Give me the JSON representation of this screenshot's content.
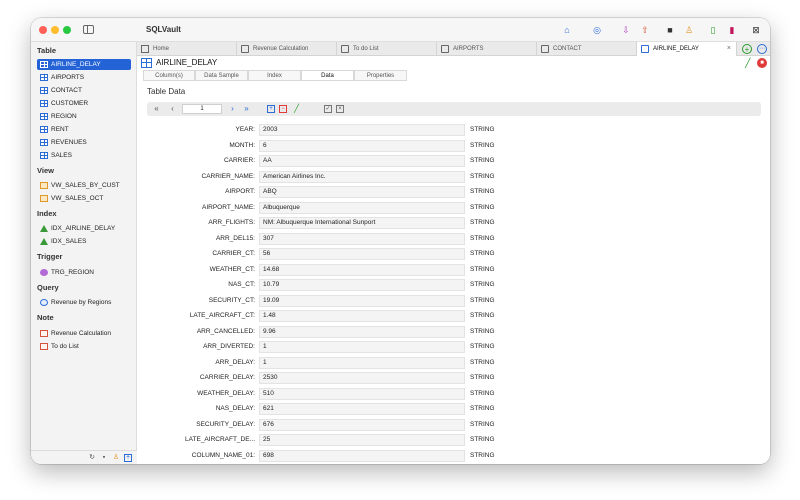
{
  "app": {
    "title": "SQLVault"
  },
  "sidebar": {
    "sections": [
      {
        "heading": "Table",
        "items": [
          {
            "label": "AIRLINE_DELAY",
            "icon": "table-icon",
            "selected": true
          },
          {
            "label": "AIRPORTS",
            "icon": "table-icon"
          },
          {
            "label": "CONTACT",
            "icon": "table-icon"
          },
          {
            "label": "CUSTOMER",
            "icon": "table-icon"
          },
          {
            "label": "REGION",
            "icon": "table-icon"
          },
          {
            "label": "RENT",
            "icon": "table-icon"
          },
          {
            "label": "REVENUES",
            "icon": "table-icon"
          },
          {
            "label": "SALES",
            "icon": "table-icon"
          }
        ]
      },
      {
        "heading": "View",
        "items": [
          {
            "label": "VW_SALES_BY_CUST",
            "icon": "view-icon"
          },
          {
            "label": "VW_SALES_OCT",
            "icon": "view-icon"
          }
        ]
      },
      {
        "heading": "Index",
        "items": [
          {
            "label": "IDX_AIRLINE_DELAY",
            "icon": "index-icon"
          },
          {
            "label": "IDX_SALES",
            "icon": "index-icon"
          }
        ]
      },
      {
        "heading": "Trigger",
        "items": [
          {
            "label": "TRG_REGION",
            "icon": "trigger-icon"
          }
        ]
      },
      {
        "heading": "Query",
        "items": [
          {
            "label": "Revenue by Regions",
            "icon": "query-icon"
          }
        ]
      },
      {
        "heading": "Note",
        "items": [
          {
            "label": "Revenue Calculation",
            "icon": "note-icon"
          },
          {
            "label": "To do List",
            "icon": "note-icon"
          }
        ]
      }
    ]
  },
  "tabs": [
    {
      "label": "Home",
      "icon": "home-icon"
    },
    {
      "label": "Revenue Calculation",
      "icon": "note-icon"
    },
    {
      "label": "To do List",
      "icon": "note-icon"
    },
    {
      "label": "AIRPORTS",
      "icon": "table-icon"
    },
    {
      "label": "CONTACT",
      "icon": "table-icon"
    },
    {
      "label": "AIRLINE_DELAY",
      "icon": "table-icon",
      "active": true,
      "close": "×"
    }
  ],
  "object": {
    "title": "AIRLINE_DELAY"
  },
  "subtabs": [
    {
      "label": "Column(s)"
    },
    {
      "label": "Data Sample"
    },
    {
      "label": "Index"
    },
    {
      "label": "Data",
      "active": true
    },
    {
      "label": "Properties"
    }
  ],
  "table_data": {
    "title": "Table Data",
    "current_page": "1",
    "rows": [
      {
        "name": "YEAR:",
        "value": "2003",
        "type": "STRING"
      },
      {
        "name": "MONTH:",
        "value": "6",
        "type": "STRING"
      },
      {
        "name": "CARRIER:",
        "value": "AA",
        "type": "STRING"
      },
      {
        "name": "CARRIER_NAME:",
        "value": "American Airlines Inc.",
        "type": "STRING"
      },
      {
        "name": "AIRPORT:",
        "value": "ABQ",
        "type": "STRING"
      },
      {
        "name": "AIRPORT_NAME:",
        "value": "Albuquerque",
        "type": "STRING"
      },
      {
        "name": "ARR_FLIGHTS:",
        "value": " NM: Albuquerque International Sunport",
        "type": "STRING"
      },
      {
        "name": "ARR_DEL15:",
        "value": "307",
        "type": "STRING"
      },
      {
        "name": "CARRIER_CT:",
        "value": "56",
        "type": "STRING"
      },
      {
        "name": "WEATHER_CT:",
        "value": "14.68",
        "type": "STRING"
      },
      {
        "name": "NAS_CT:",
        "value": "10.79",
        "type": "STRING"
      },
      {
        "name": "SECURITY_CT:",
        "value": "19.09",
        "type": "STRING"
      },
      {
        "name": "LATE_AIRCRAFT_CT:",
        "value": "1.48",
        "type": "STRING"
      },
      {
        "name": "ARR_CANCELLED:",
        "value": "9.96",
        "type": "STRING"
      },
      {
        "name": "ARR_DIVERTED:",
        "value": "1",
        "type": "STRING"
      },
      {
        "name": "ARR_DELAY:",
        "value": "1",
        "type": "STRING"
      },
      {
        "name": "CARRIER_DELAY:",
        "value": "2530",
        "type": "STRING"
      },
      {
        "name": "WEATHER_DELAY:",
        "value": "510",
        "type": "STRING"
      },
      {
        "name": "NAS_DELAY:",
        "value": "621",
        "type": "STRING"
      },
      {
        "name": "SECURITY_DELAY:",
        "value": "676",
        "type": "STRING"
      },
      {
        "name": "LATE_AIRCRAFT_DE...",
        "value": "25",
        "type": "STRING"
      },
      {
        "name": "COLUMN_NAME_01:",
        "value": "698",
        "type": "STRING"
      }
    ]
  },
  "colors": {
    "accent": "#2463d6",
    "add": "#2a9a2a",
    "delete": "#e03a3a"
  }
}
